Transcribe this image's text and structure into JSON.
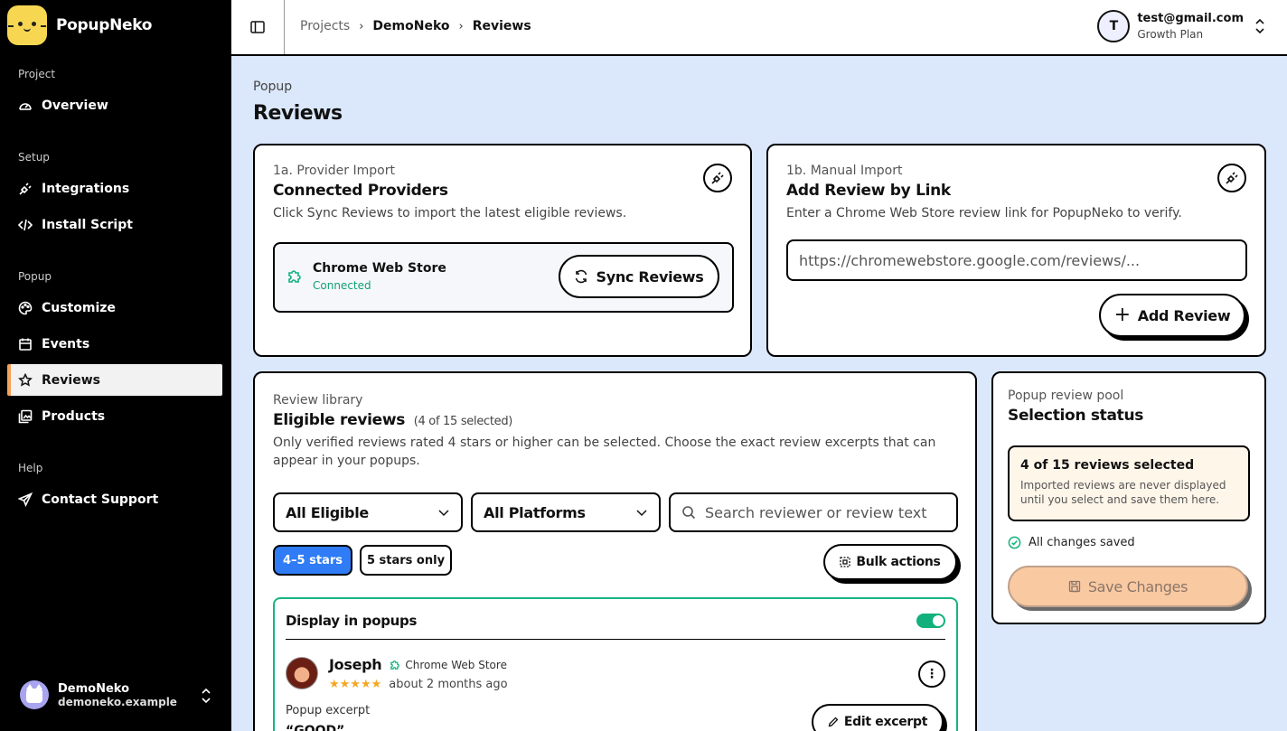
{
  "app": {
    "name": "PopupNeko"
  },
  "sidebar": {
    "sections": [
      "Project",
      "Setup",
      "Popup",
      "Help"
    ],
    "items": [
      "Overview",
      "Integrations",
      "Install Script",
      "Customize",
      "Events",
      "Reviews",
      "Products",
      "Contact Support"
    ],
    "active": "Reviews",
    "account": {
      "name": "DemoNeko",
      "domain": "demoneko.example"
    }
  },
  "header": {
    "breadcrumbs": [
      "Projects",
      "DemoNeko",
      "Reviews"
    ],
    "user": {
      "initial": "T",
      "email": "test@gmail.com",
      "plan": "Growth Plan"
    }
  },
  "page": {
    "kicker": "Popup",
    "title": "Reviews"
  },
  "provider_card": {
    "kicker": "1a. Provider Import",
    "title": "Connected Providers",
    "desc": "Click Sync Reviews to import the latest eligible reviews.",
    "provider_name": "Chrome Web Store",
    "provider_status": "Connected",
    "sync_label": "Sync Reviews"
  },
  "manual_card": {
    "kicker": "1b. Manual Import",
    "title": "Add Review by Link",
    "desc": "Enter a Chrome Web Store review link for PopupNeko to verify.",
    "input_placeholder": "https://chromewebstore.google.com/reviews/...",
    "add_label": "Add Review"
  },
  "library": {
    "kicker": "Review library",
    "title": "Eligible reviews",
    "count": "(4 of 15 selected)",
    "desc": "Only verified reviews rated 4 stars or higher can be selected. Choose the exact review excerpts that can appear in your popups.",
    "filter_status": "All Eligible",
    "filter_platform": "All Platforms",
    "search_placeholder": "Search reviewer or review text",
    "chips": [
      "4–5 stars",
      "5 stars only"
    ],
    "bulk_label": "Bulk actions",
    "display_label": "Display in popups",
    "review": {
      "name": "Joseph",
      "source": "Chrome Web Store",
      "rating": 5,
      "time": "about 2 months ago",
      "excerpt_label": "Popup excerpt",
      "excerpt_text": "“GOOD”",
      "edit_label": "Edit excerpt"
    }
  },
  "pool": {
    "kicker": "Popup review pool",
    "title": "Selection status",
    "summary_title": "4 of 15 reviews selected",
    "summary_desc": "Imported reviews are never displayed until you select and save them here.",
    "saved_status": "All changes saved",
    "save_label": "Save Changes"
  },
  "colors": {
    "accent": "#2f7cf6",
    "success": "#12b07d",
    "page_bg": "#dbe8fb",
    "save_bg": "#f9c9a2",
    "sidebar_active_bar": "#f5a25d",
    "star": "#f5a623"
  }
}
